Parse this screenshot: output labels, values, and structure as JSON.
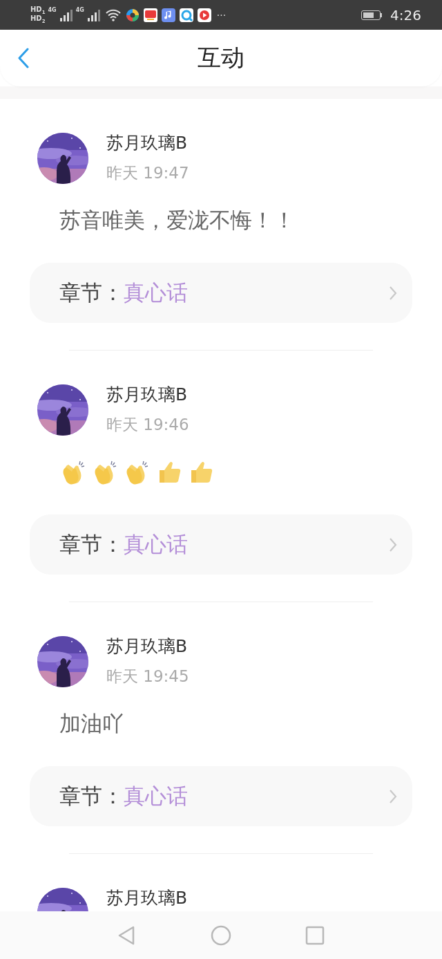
{
  "status_bar": {
    "sim_labels": [
      {
        "label": "HD",
        "slot": "1"
      },
      {
        "label": "HD",
        "slot": "2"
      }
    ],
    "networks": [
      "4G",
      "4G"
    ],
    "more": "···",
    "time": "4:26"
  },
  "header": {
    "title": "互动"
  },
  "comments": [
    {
      "user": "苏月玖璃B",
      "time": "昨天 19:47",
      "content": {
        "kind": "text",
        "text": "苏音唯美，爱泷不悔！！"
      },
      "chapter_label": "章节：",
      "chapter": "真心话"
    },
    {
      "user": "苏月玖璃B",
      "time": "昨天 19:46",
      "content": {
        "kind": "emoji",
        "emojis": [
          {
            "kind": "clap"
          },
          {
            "kind": "clap"
          },
          {
            "kind": "clap"
          },
          {
            "kind": "thumbs-up"
          },
          {
            "kind": "thumbs-up"
          }
        ]
      },
      "chapter_label": "章节：",
      "chapter": "真心话"
    },
    {
      "user": "苏月玖璃B",
      "time": "昨天 19:45",
      "content": {
        "kind": "text",
        "text": "加油吖"
      },
      "chapter_label": "章节：",
      "chapter": "真心话"
    },
    {
      "user": "苏月玖璃B"
    }
  ]
}
